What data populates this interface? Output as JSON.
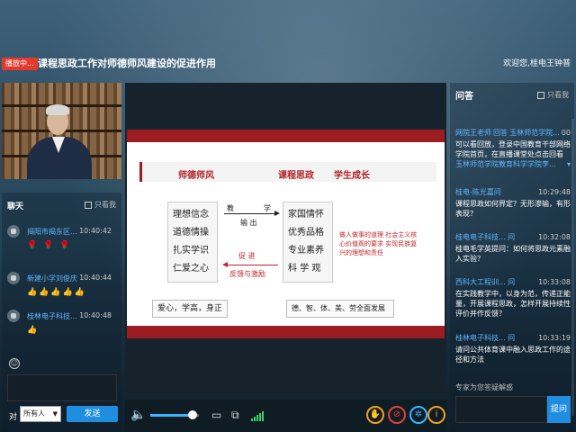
{
  "header": {
    "live_badge": "播放中...",
    "title": "课程思政工作对师德师风建设的促进作用",
    "welcome": "欢迎您,桂电王钟普"
  },
  "chat": {
    "title": "聊天",
    "only_me_label": "只看我",
    "messages": [
      {
        "name": "揭阳市揭东区...",
        "time": "10:40:42",
        "content": "🌹 🌹 🌹"
      },
      {
        "name": "新建小学刘俊庆",
        "time": "10:40:44",
        "content": "👍👍👍👍👍"
      },
      {
        "name": "桂林电子科技...",
        "time": "10:40:48",
        "content": "👍"
      }
    ],
    "to_label": "对",
    "to_select": "所有人",
    "send_label": "发送"
  },
  "slide": {
    "header_col1": "师德师风",
    "header_col2": "课程思政",
    "header_col3": "学生成长",
    "left_items": [
      "理想信念",
      "道德情操",
      "扎实学识",
      "仁爱之心"
    ],
    "right_items": [
      "家国情怀",
      "优秀品格",
      "专业素养",
      "科 学 观"
    ],
    "teach": "教",
    "learn": "学",
    "output": "输 出",
    "promote": "促 进",
    "feedback": "反馈与激励",
    "red_note": "做人做事的道理 社会主义核心价值观的要求 实现民族复兴的理想和责任",
    "bottom_left": "爱心，学高，身正",
    "bottom_right": "德、智、体、美、劳全面发展"
  },
  "qa": {
    "title": "问答",
    "only_me_label": "只看我",
    "items": [
      {
        "name": "网院王老师",
        "extra": "回答",
        "target": "玉林师范学院...",
        "time": "00",
        "text": "可以看回放，登录中国教育干部网络学院首页，在直播课堂处点击回看"
      },
      {
        "name": "玉林师范学院教育科学学院李...",
        "time": "",
        "text": ""
      },
      {
        "name": "桂电-陈光嘉问",
        "time": "10:29:48",
        "text": "课程思政如何界定？无形渗输，有形表现？"
      },
      {
        "name": "桂电电子科技... 问",
        "time": "10:32:08",
        "text": "桂电毛学英提问：如何将思政元素融入实验？"
      },
      {
        "name": "西科大工程训... 问",
        "time": "10:33:08",
        "text": "在实践教学中，以身为范，传递正能量，开展课程思政，怎样开展持续性评价并作反馈？"
      },
      {
        "name": "桂林电子科技... 问",
        "time": "10:33:19",
        "text": "请问公共体育课中融入思政工作的途径和方法"
      }
    ],
    "input_placeholder": "专家为您答疑解惑",
    "send_label": "提问"
  },
  "colors": {
    "accent": "#1f8de0",
    "live": "#e23b2e",
    "slide_red": "#9d1c22"
  }
}
